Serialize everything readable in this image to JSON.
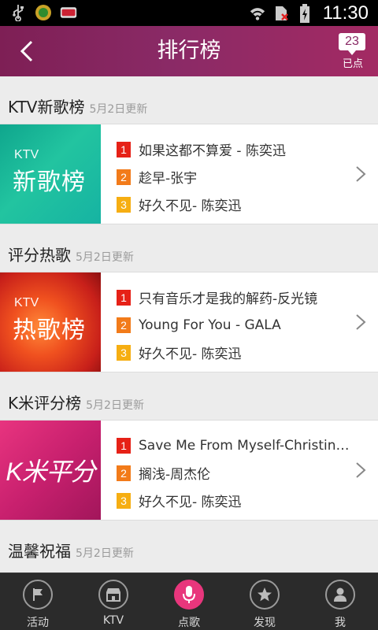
{
  "statusbar": {
    "time": "11:30",
    "left_icons": [
      "usb-icon",
      "app-notification-icon",
      "ktv-notification-icon"
    ],
    "right_icons": [
      "wifi-icon",
      "no-sim-icon",
      "battery-charging-icon"
    ]
  },
  "header": {
    "back_icon": "chevron-left-icon",
    "title": "排行榜",
    "queue_count": "23",
    "queue_label": "已点"
  },
  "sections": [
    {
      "title": "KTV新歌榜",
      "date": "5月2日更新",
      "thumb_ktv": "KTV",
      "thumb_name": "新歌榜",
      "songs": [
        {
          "rank": "1",
          "text": "如果这都不算爱 - 陈奕迅"
        },
        {
          "rank": "2",
          "text": "趁早-张宇"
        },
        {
          "rank": "3",
          "text": "好久不见- 陈奕迅"
        }
      ]
    },
    {
      "title": "评分热歌",
      "date": "5月2日更新",
      "thumb_ktv": "KTV",
      "thumb_name": "热歌榜",
      "songs": [
        {
          "rank": "1",
          "text": "只有音乐才是我的解药-反光镜"
        },
        {
          "rank": "2",
          "text": "Young For You - GALA"
        },
        {
          "rank": "3",
          "text": "好久不见- 陈奕迅"
        }
      ]
    },
    {
      "title": "K米评分榜",
      "date": "5月2日更新",
      "thumb_logo": "K米平分",
      "songs": [
        {
          "rank": "1",
          "text": "Save Me From Myself-Christin…"
        },
        {
          "rank": "2",
          "text": "搁浅-周杰伦"
        },
        {
          "rank": "3",
          "text": "好久不见- 陈奕迅"
        }
      ]
    },
    {
      "title": "温馨祝福",
      "date": "5月2日更新"
    }
  ],
  "bottomnav": [
    {
      "label": "活动",
      "icon": "flag-icon"
    },
    {
      "label": "KTV",
      "icon": "store-icon"
    },
    {
      "label": "点歌",
      "icon": "microphone-icon",
      "active": true
    },
    {
      "label": "发现",
      "icon": "star-icon"
    },
    {
      "label": "我",
      "icon": "user-icon"
    }
  ],
  "colors": {
    "header": "#8a2a66",
    "active_tab": "#e8367c",
    "rank1": "#e62117",
    "rank2": "#f27b1a",
    "rank3": "#f6ae12"
  }
}
